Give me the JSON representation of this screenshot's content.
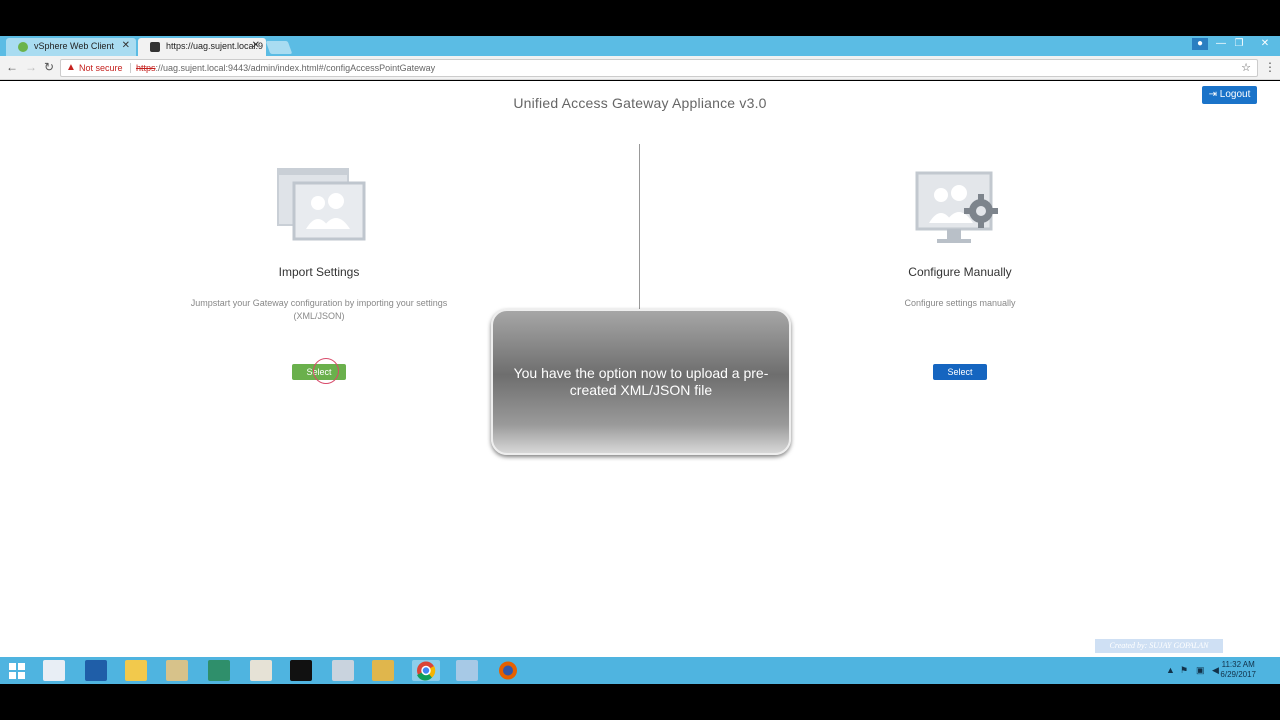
{
  "browser": {
    "tabs": [
      {
        "label": "vSphere Web Client",
        "active": false
      },
      {
        "label": "https://uag.sujent.local:9",
        "active": true
      }
    ],
    "security_label": "Not secure",
    "url_scheme": "https",
    "url_rest": "://uag.sujent.local:9443/admin/index.html#/configAccessPointGateway"
  },
  "page": {
    "title": "Unified Access Gateway Appliance v3.0",
    "logout_label": "Logout",
    "import": {
      "title": "Import Settings",
      "description_line1": "Jumpstart your Gateway configuration by importing your settings",
      "description_line2": "(XML/JSON)",
      "button_label": "Select"
    },
    "manual": {
      "title": "Configure Manually",
      "description": "Configure settings manually",
      "button_label": "Select"
    },
    "callout_text": "You have the option now to upload a pre-created XML/JSON file",
    "watermark": "Created by: SUJAY GOPALAN"
  },
  "taskbar": {
    "time": "11:32 AM",
    "date": "6/29/2017"
  },
  "colors": {
    "accent_blue": "#1a73c9",
    "select_green": "#6ab04c",
    "taskbar": "#4fb4e0"
  }
}
